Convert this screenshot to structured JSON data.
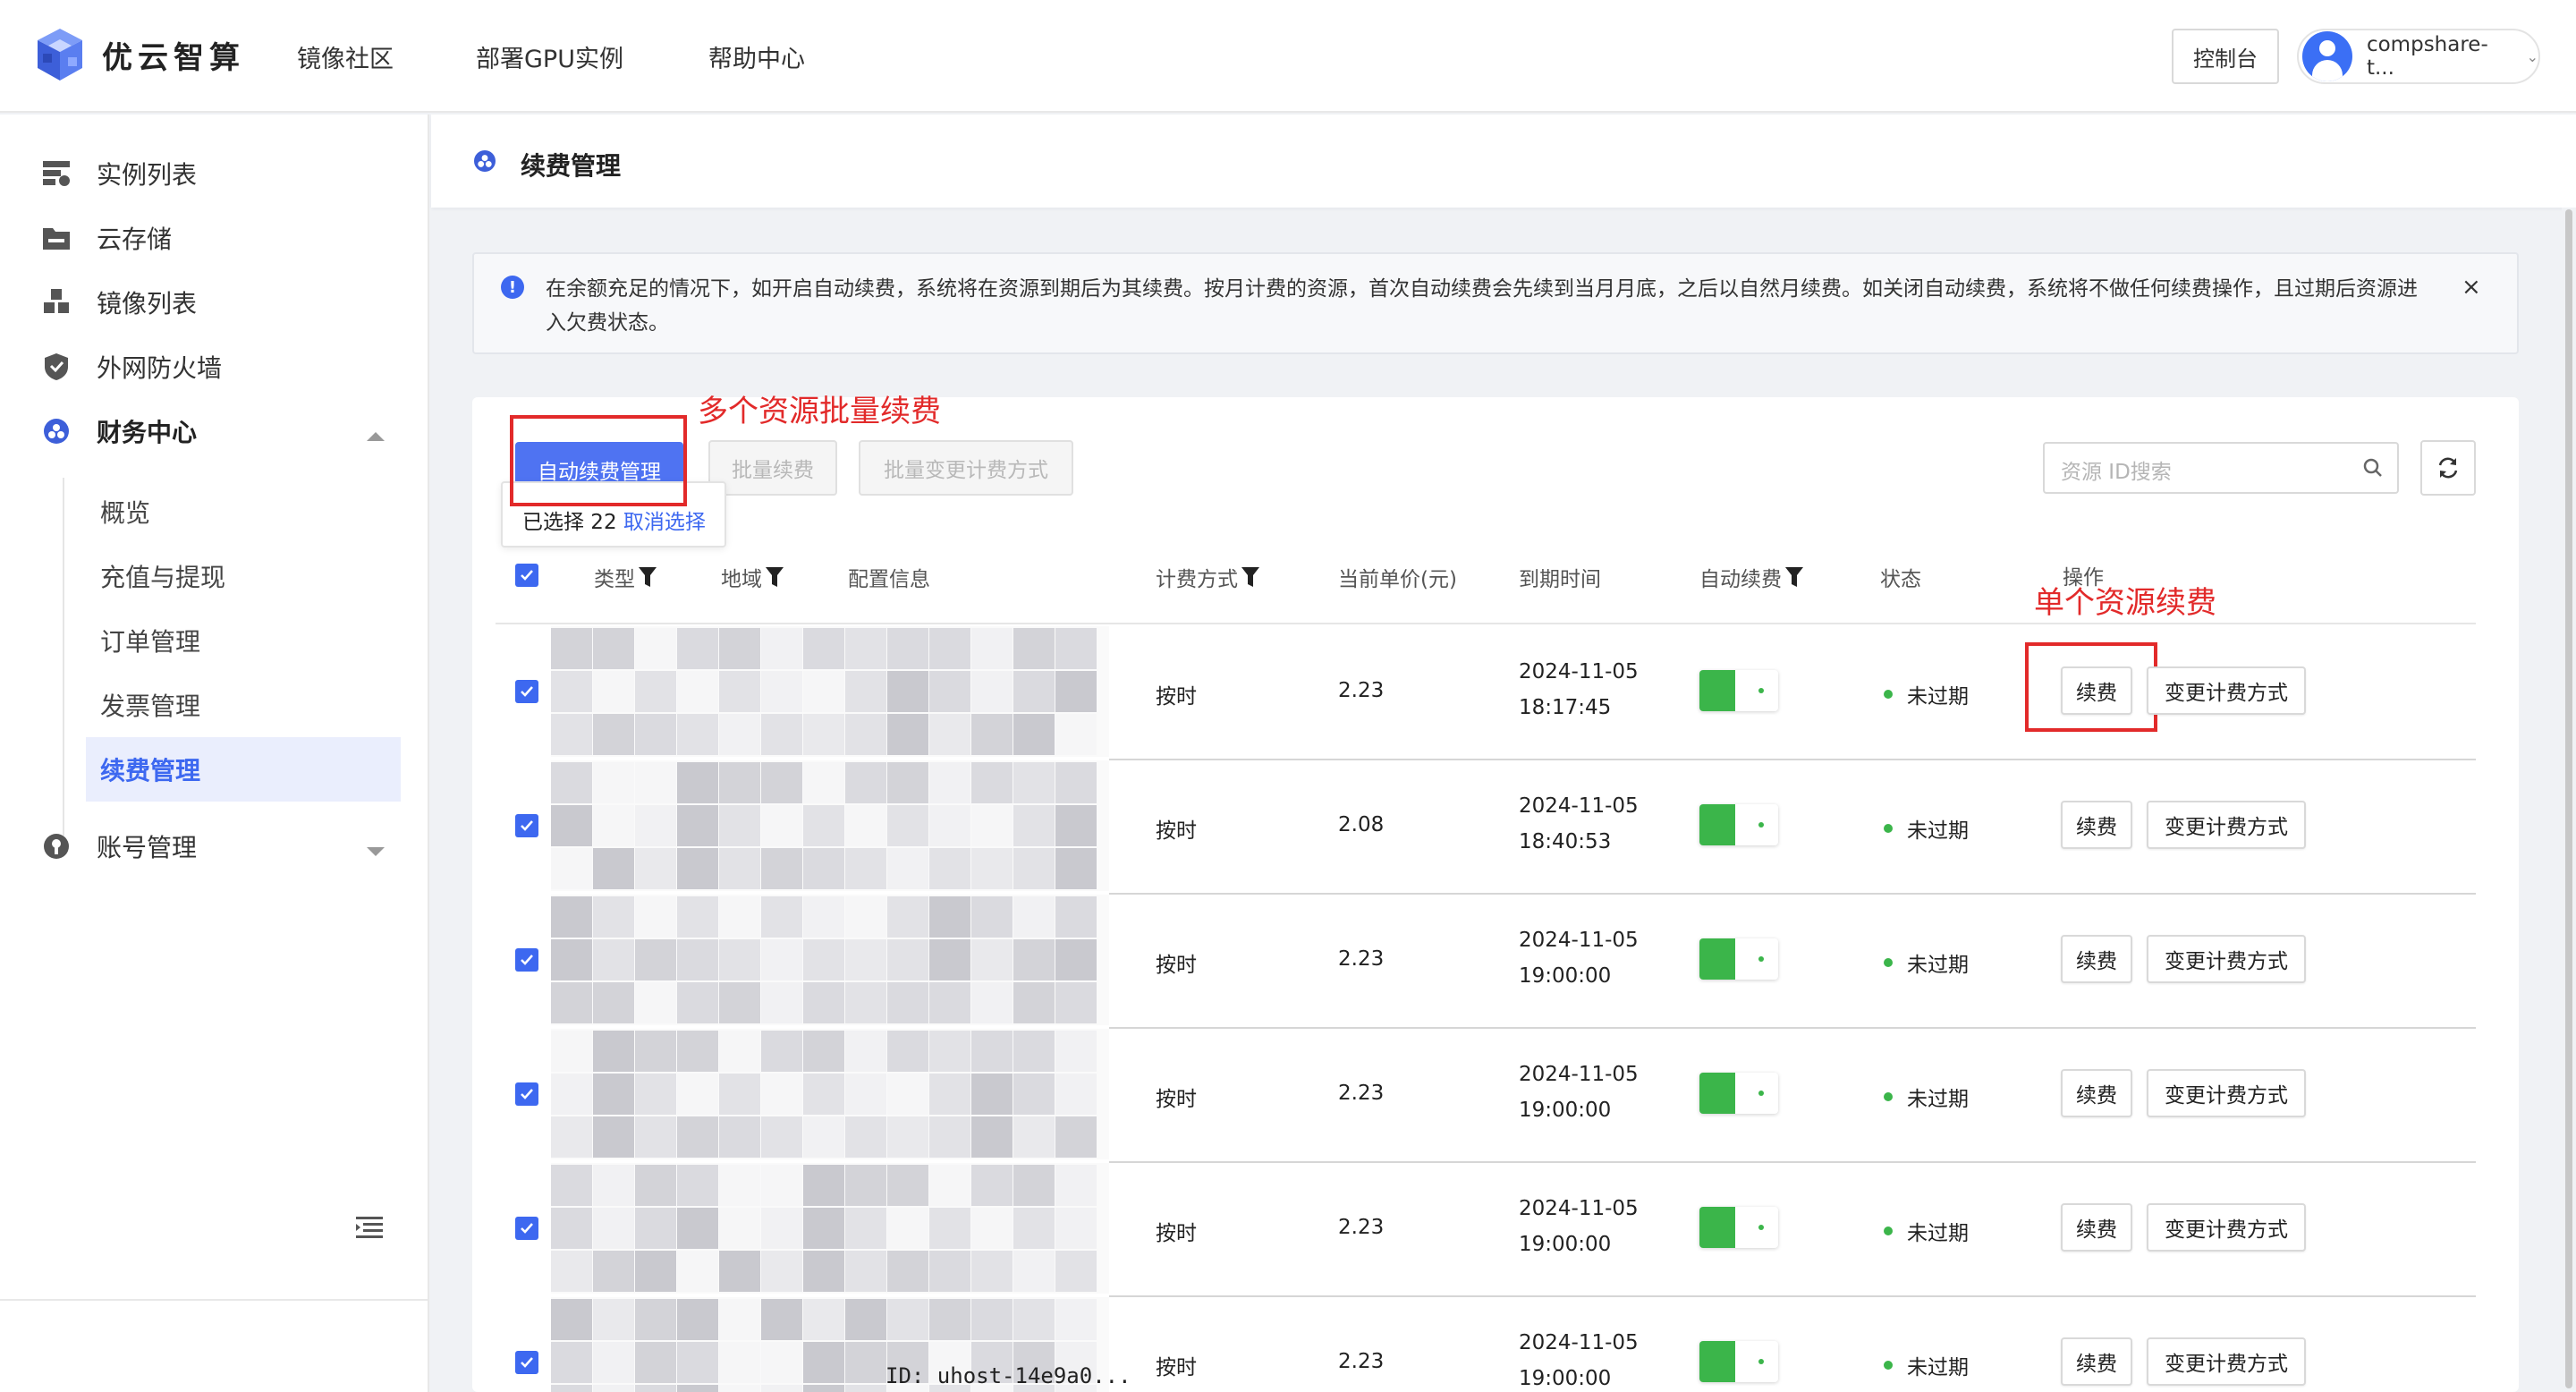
{
  "brand": {
    "name": "优云智算"
  },
  "nav": {
    "items": [
      "镜像社区",
      "部署GPU实例",
      "帮助中心"
    ],
    "console": "控制台",
    "user": "compshare-t...",
    "caret": "⌄"
  },
  "sidebar": {
    "items": [
      "实例列表",
      "云存储",
      "镜像列表",
      "外网防火墙",
      "财务中心",
      "账号管理"
    ],
    "finance_sub": [
      "概览",
      "充值与提现",
      "订单管理",
      "发票管理",
      "续费管理"
    ]
  },
  "page": {
    "title": "续费管理"
  },
  "alert": {
    "text": "在余额充足的情况下，如开启自动续费，系统将在资源到期后为其续费。按月计费的资源，首次自动续费会先续到当月月底，之后以自然月续费。如关闭自动续费，系统将不做任何续费操作，且过期后资源进入欠费状态。",
    "close": "×",
    "icon": "!"
  },
  "toolbar": {
    "auto_renew": "自动续费管理",
    "batch_renew": "批量续费",
    "batch_change": "批量变更计费方式",
    "selected_prefix": "已选择 22",
    "cancel_select": "取消选择",
    "search_placeholder": "资源 ID搜索"
  },
  "annotations": {
    "batch": "多个资源批量续费",
    "single": "单个资源续费"
  },
  "table": {
    "headers": {
      "type": "类型",
      "region": "地域",
      "config": "配置信息",
      "billing": "计费方式",
      "price": "当前单价(元)",
      "expire": "到期时间",
      "auto": "自动续费",
      "status": "状态",
      "ops": "操作"
    },
    "rows": [
      {
        "billing": "按时",
        "price": "2.23",
        "date": "2024-11-05",
        "time": "18:17:45",
        "status": "未过期",
        "renew": "续费",
        "change": "变更计费方式"
      },
      {
        "billing": "按时",
        "price": "2.08",
        "date": "2024-11-05",
        "time": "18:40:53",
        "status": "未过期",
        "renew": "续费",
        "change": "变更计费方式"
      },
      {
        "billing": "按时",
        "price": "2.23",
        "date": "2024-11-05",
        "time": "19:00:00",
        "status": "未过期",
        "renew": "续费",
        "change": "变更计费方式"
      },
      {
        "billing": "按时",
        "price": "2.23",
        "date": "2024-11-05",
        "time": "19:00:00",
        "status": "未过期",
        "renew": "续费",
        "change": "变更计费方式"
      },
      {
        "billing": "按时",
        "price": "2.23",
        "date": "2024-11-05",
        "time": "19:00:00",
        "status": "未过期",
        "renew": "续费",
        "change": "变更计费方式"
      },
      {
        "billing": "按时",
        "price": "2.23",
        "date": "2024-11-05",
        "time": "19:00:00",
        "status": "未过期",
        "renew": "续费",
        "change": "变更计费方式"
      }
    ],
    "partial_id": "ID: uhost-14e9a0..."
  },
  "colors": {
    "primary": "#4f73f2",
    "annotation": "#e22a2a",
    "success": "#3bb54a"
  }
}
